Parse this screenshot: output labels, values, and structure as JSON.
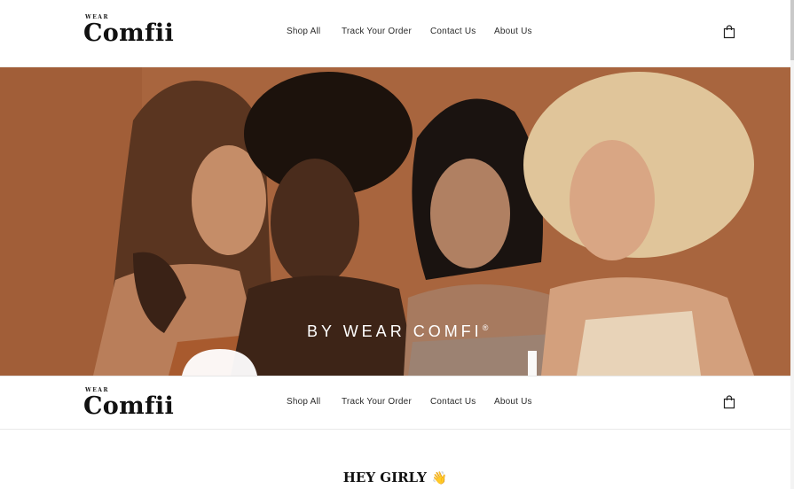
{
  "brand": {
    "logo_small": "WEAR",
    "logo_main": "Comfii"
  },
  "nav": {
    "items": [
      {
        "label": "Shop All"
      },
      {
        "label": "Track Your Order"
      },
      {
        "label": "Contact Us"
      },
      {
        "label": "About Us"
      }
    ]
  },
  "cart": {
    "icon": "shopping-bag-icon"
  },
  "hero": {
    "tagline": "BY WEAR COMFI",
    "tagline_mark": "®"
  },
  "section": {
    "greeting": "HEY GIRLY",
    "greeting_emoji": "👋"
  },
  "colors": {
    "hero_bg": "#a9673f",
    "text_dark": "#111111",
    "header_bg": "#ffffff"
  }
}
